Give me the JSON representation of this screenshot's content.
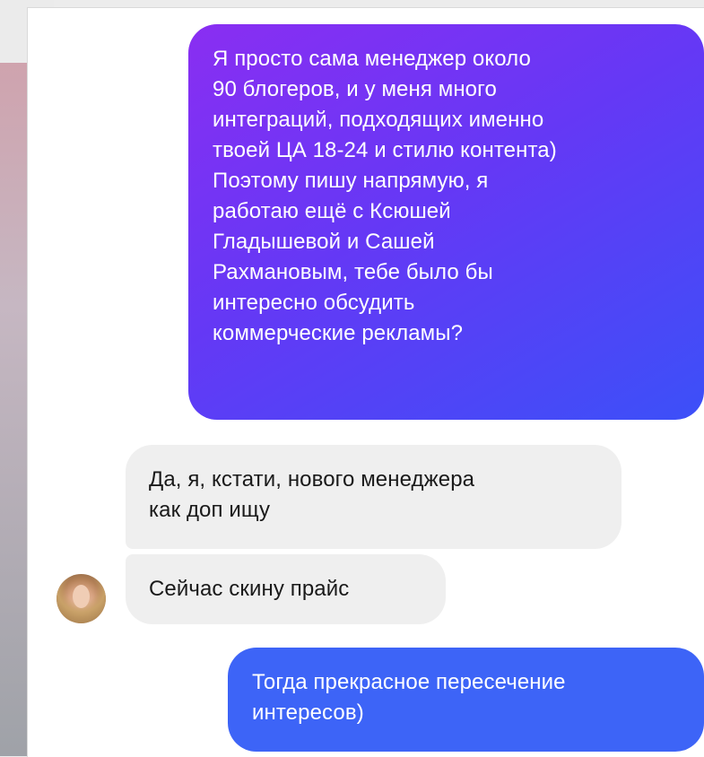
{
  "messages": {
    "outgoing_1": {
      "line1": "Я просто сама менеджер около\n90 блогеров, и у меня много\nинтеграций, подходящих именно\nтвоей ЦА 18-24 и стилю контента)",
      "line2": "Поэтому пишу напрямую, я\nработаю ещё с Ксюшей\nГладышевой и Сашей\nРахмановым, тебе было бы\nинтересно обсудить\nкоммерческие рекламы?"
    },
    "incoming_1": {
      "text": "Да, я, кстати, нового менеджера\nкак доп ищу"
    },
    "incoming_2": {
      "text": "Сейчас скину прайс"
    },
    "outgoing_2": {
      "text": "Тогда прекрасное пересечение\nинтересов)"
    }
  },
  "colors": {
    "outgoing_gradient_start": "#8a2ef2",
    "outgoing_gradient_end": "#3c50f8",
    "outgoing_solid": "#3d64f7",
    "incoming_bg": "#efefef"
  }
}
